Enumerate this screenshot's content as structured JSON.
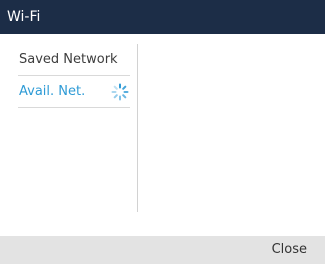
{
  "window": {
    "title": "Wi-Fi"
  },
  "sidebar": {
    "items": [
      {
        "label": "Saved Network",
        "active": false
      },
      {
        "label": "Avail. Net.",
        "active": true,
        "status_icon": "loading-spinner-icon"
      }
    ]
  },
  "footer": {
    "close_label": "Close"
  },
  "colors": {
    "titlebar_bg": "#1c2d47",
    "accent": "#2e9bd6",
    "footer_bg": "#e3e3e3"
  }
}
